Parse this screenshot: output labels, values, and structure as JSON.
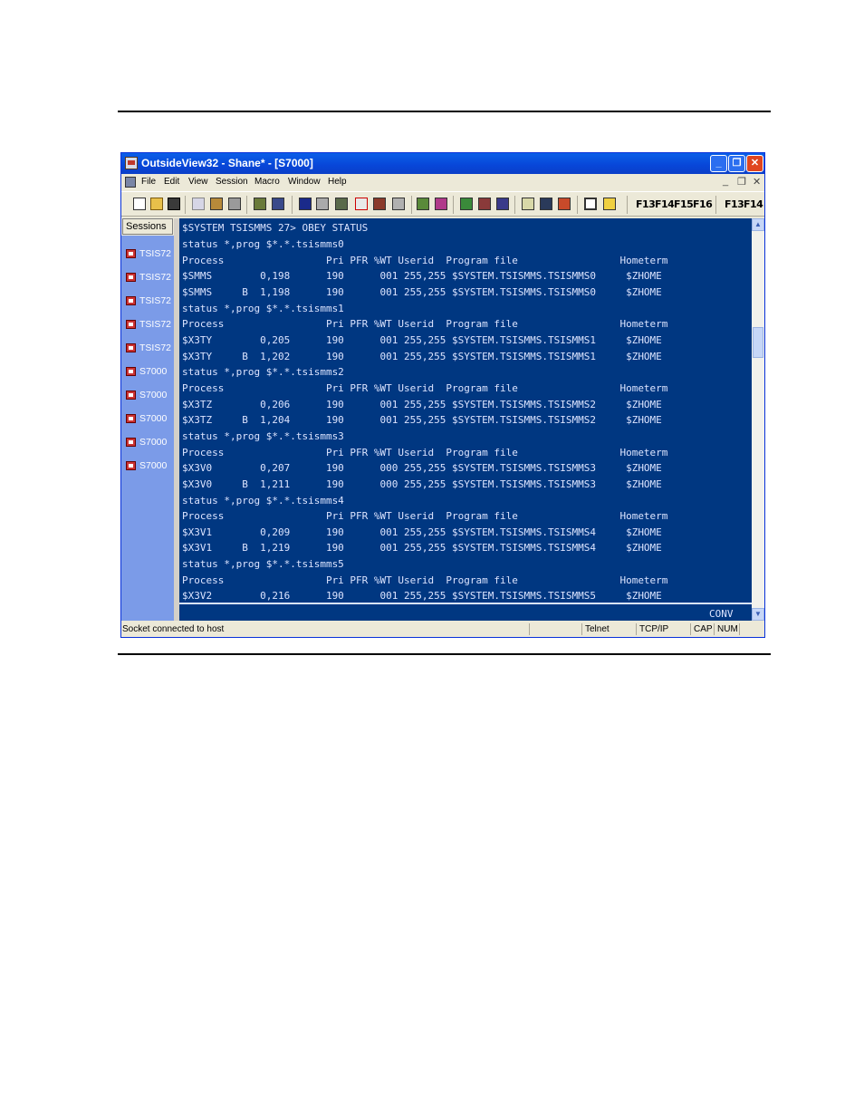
{
  "window": {
    "title": "OutsideView32 - Shane* - [S7000]",
    "min": "_",
    "max": "❐",
    "close": "✕"
  },
  "menubar": {
    "items": [
      "File",
      "Edit",
      "View",
      "Session",
      "Macro",
      "Window",
      "Help"
    ],
    "mdi_min": "_",
    "mdi_restore": "❐",
    "mdi_close": "✕"
  },
  "toolbar": {
    "icons": [
      "new-icon",
      "open-icon",
      "save-icon",
      "copy-icon",
      "paste-icon",
      "print-icon",
      "settings-icon",
      "binary-icon",
      "screen-icon",
      "binary-transfer-icon",
      "binary-file-icon",
      "function-icon",
      "book-icon",
      "printer-icon",
      "tool-icon",
      "tool2-icon",
      "tool3-icon",
      "tool4-icon",
      "tool5-icon",
      "chart-icon",
      "disk-icon",
      "tile-icon",
      "window-icon",
      "help-icon"
    ],
    "fkeys": [
      "F13",
      "F14",
      "F15",
      "F16"
    ],
    "fkeys2": [
      "F13",
      "F14"
    ]
  },
  "sessions": {
    "header": "Sessions",
    "items": [
      "TSIS72",
      "TSIS72",
      "TSIS72",
      "TSIS72",
      "TSIS72",
      "S7000",
      "S7000",
      "S7000",
      "S7000",
      "S7000"
    ]
  },
  "terminal": {
    "lines": [
      "$SYSTEM TSISMMS 27> OBEY STATUS",
      "status *,prog $*.*.tsismms0",
      "Process                 Pri PFR %WT Userid  Program file                 Hometerm",
      "$SMMS        0,198      190      001 255,255 $SYSTEM.TSISMMS.TSISMMS0     $ZHOME",
      "$SMMS     B  1,198      190      001 255,255 $SYSTEM.TSISMMS.TSISMMS0     $ZHOME",
      "status *,prog $*.*.tsismms1",
      "Process                 Pri PFR %WT Userid  Program file                 Hometerm",
      "$X3TY        0,205      190      001 255,255 $SYSTEM.TSISMMS.TSISMMS1     $ZHOME",
      "$X3TY     B  1,202      190      001 255,255 $SYSTEM.TSISMMS.TSISMMS1     $ZHOME",
      "status *,prog $*.*.tsismms2",
      "Process                 Pri PFR %WT Userid  Program file                 Hometerm",
      "$X3TZ        0,206      190      001 255,255 $SYSTEM.TSISMMS.TSISMMS2     $ZHOME",
      "$X3TZ     B  1,204      190      001 255,255 $SYSTEM.TSISMMS.TSISMMS2     $ZHOME",
      "status *,prog $*.*.tsismms3",
      "Process                 Pri PFR %WT Userid  Program file                 Hometerm",
      "$X3V0        0,207      190      000 255,255 $SYSTEM.TSISMMS.TSISMMS3     $ZHOME",
      "$X3V0     B  1,211      190      000 255,255 $SYSTEM.TSISMMS.TSISMMS3     $ZHOME",
      "status *,prog $*.*.tsismms4",
      "Process                 Pri PFR %WT Userid  Program file                 Hometerm",
      "$X3V1        0,209      190      001 255,255 $SYSTEM.TSISMMS.TSISMMS4     $ZHOME",
      "$X3V1     B  1,219      190      001 255,255 $SYSTEM.TSISMMS.TSISMMS4     $ZHOME",
      "status *,prog $*.*.tsismms5",
      "Process                 Pri PFR %WT Userid  Program file                 Hometerm",
      "$X3V2        0,216      190      001 255,255 $SYSTEM.TSISMMS.TSISMMS5     $ZHOME"
    ],
    "oia": "CONV"
  },
  "scrollbar": {
    "up": "▲",
    "down": "▼"
  },
  "statusbar": {
    "message": "Socket connected to host",
    "protocol": "Telnet",
    "transport": "TCP/IP",
    "cap": "CAP",
    "num": "NUM"
  },
  "colors": {
    "terminal_bg": "#003781",
    "terminal_fg": "#dce4ff",
    "session_panel": "#7b9be8",
    "titlebar": "#0a54e3"
  }
}
